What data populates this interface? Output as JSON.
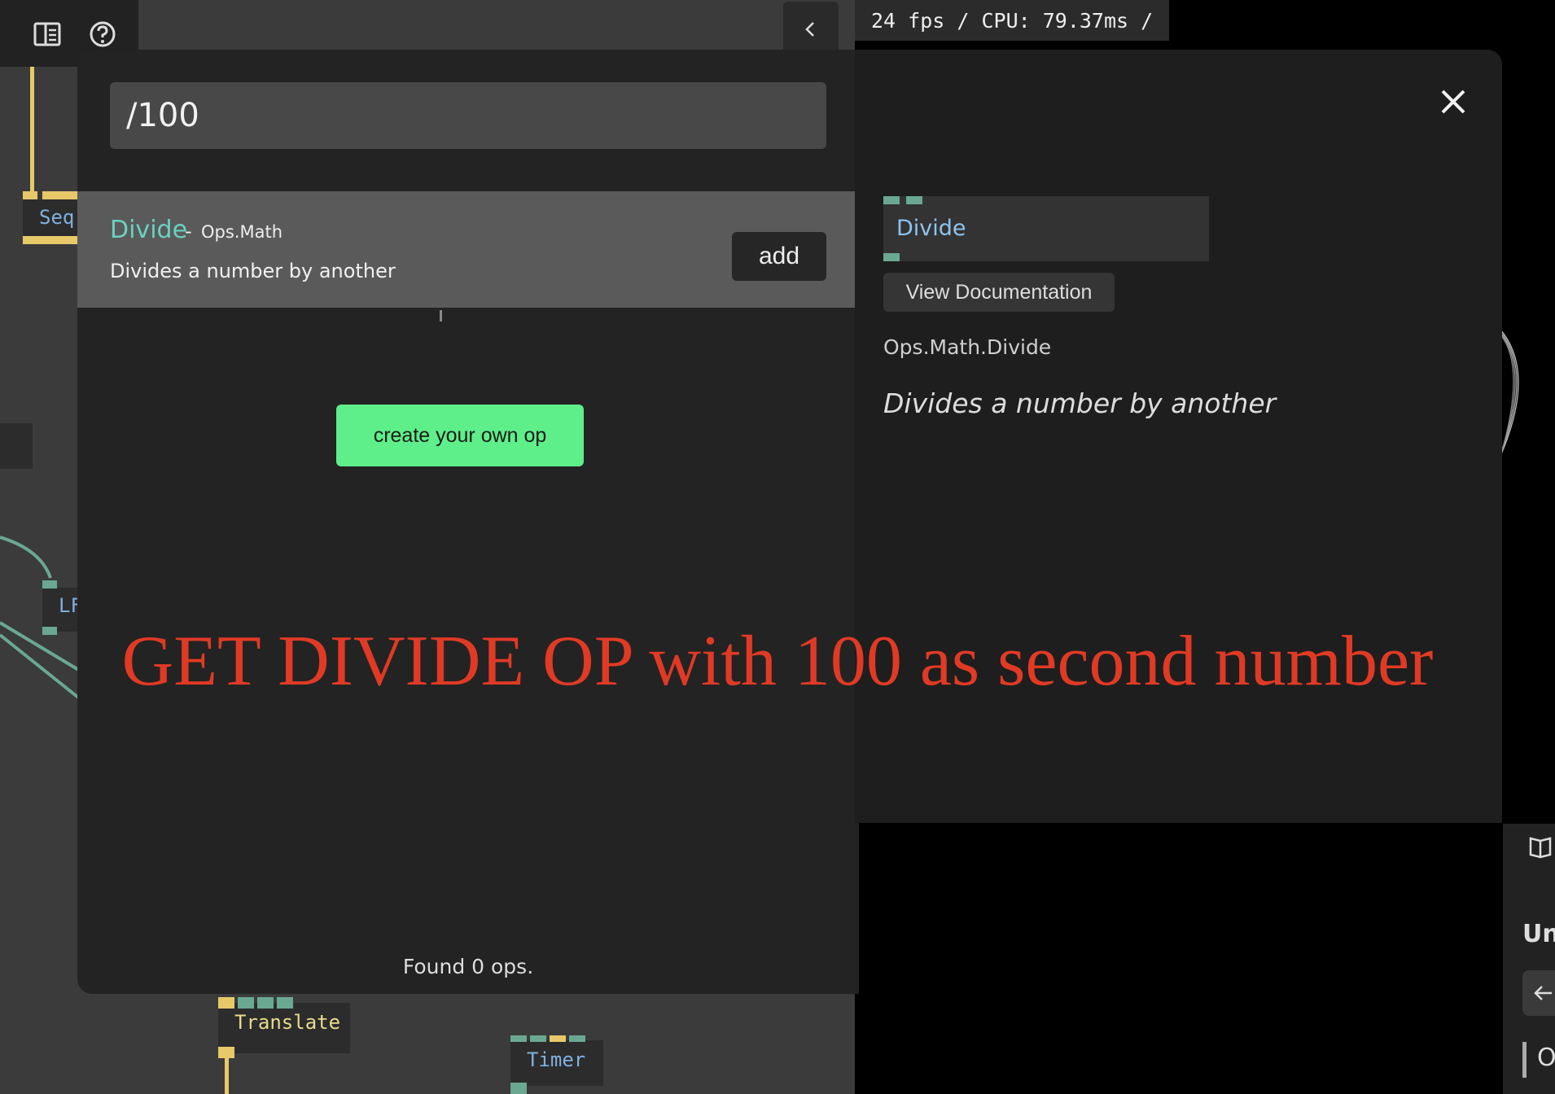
{
  "toolbar": {
    "icons": [
      "panel-layout-icon",
      "help-icon"
    ]
  },
  "canvas_nodes": {
    "sequence": "Seq",
    "lfo": "LF",
    "translate": "Translate",
    "timer": "Timer"
  },
  "fps_readout": "24 fps / CPU: 79.37ms /",
  "op_search": {
    "query": "/100",
    "results": [
      {
        "name": "Divide",
        "separator": "-",
        "namespace": "Ops.Math",
        "description": "Divides a number by another",
        "add_label": "add"
      }
    ],
    "create_label": "create your own op",
    "found_text": "Found 0 ops."
  },
  "preview": {
    "node_title": "Divide",
    "doc_label": "View Documentation",
    "full_name": "Ops.Math.Divide",
    "summary": "Divides a number by another"
  },
  "overlay_caption": "GET DIVIDE OP with 100 as second number",
  "right_edge": {
    "label_un": "Un",
    "label_o": "O"
  },
  "colors": {
    "accent_teal": "#6ad1c0",
    "create_green": "#5eef8a",
    "caption_red": "#e03a25",
    "port_yellow": "#e7c96a",
    "port_teal": "#6aa891"
  }
}
